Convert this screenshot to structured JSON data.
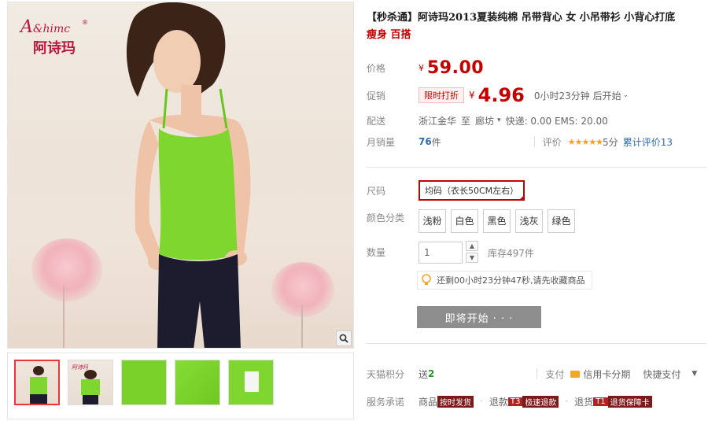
{
  "brand": {
    "logo_text": "Ashima",
    "logo_cn": "阿诗玛"
  },
  "product": {
    "title_prefix": "【秒杀通】",
    "title_main": "阿诗玛2013夏装纯棉 吊带背心 女 小吊带衫 小背心打底",
    "title_hl": "瘦身 百搭"
  },
  "price": {
    "label": "价格",
    "currency": "¥",
    "value": "59.00"
  },
  "promo": {
    "label": "促销",
    "tag": "限时打折",
    "currency": "¥",
    "value": "4.96",
    "countdown": "0小时23分钟 后开始"
  },
  "shipping": {
    "label": "配送",
    "from": "浙江金华",
    "to_word": "至",
    "to": "廊坊",
    "fees": "快递: 0.00  EMS: 20.00"
  },
  "sales": {
    "label": "月销量",
    "count": "76",
    "unit": "件",
    "review_label": "评价",
    "stars": "★★★★★",
    "score": "5分",
    "total_reviews": "累计评价13"
  },
  "size": {
    "label": "尺码",
    "selected": "均码（衣长50CM左右）"
  },
  "color": {
    "label": "颜色分类",
    "options": [
      "浅粉",
      "白色",
      "黑色",
      "浅灰",
      "绿色"
    ]
  },
  "quantity": {
    "label": "数量",
    "value": "1",
    "stock": "库存497件"
  },
  "tip": {
    "text": "还剩00小时23分钟47秒,请先收藏商品"
  },
  "buy_button": {
    "label": "即将开始 · · ·"
  },
  "points": {
    "label": "天猫积分",
    "value_prefix": "送",
    "value": "2",
    "pay_label": "支付",
    "credit_card": "信用卡分期",
    "quick_pay": "快捷支付"
  },
  "service": {
    "label": "服务承诺",
    "item1_prefix": "商品",
    "item1_tag": "按时发货",
    "item2_prefix": "退款",
    "item2_tag": "极速退款",
    "item2_badge": "T3",
    "item3_prefix": "退货",
    "item3_tag": "退货保障卡",
    "item3_badge": "T1"
  },
  "colors": {
    "accent": "#c40000",
    "muted": "#888888",
    "product_green": "#7ed62e"
  }
}
